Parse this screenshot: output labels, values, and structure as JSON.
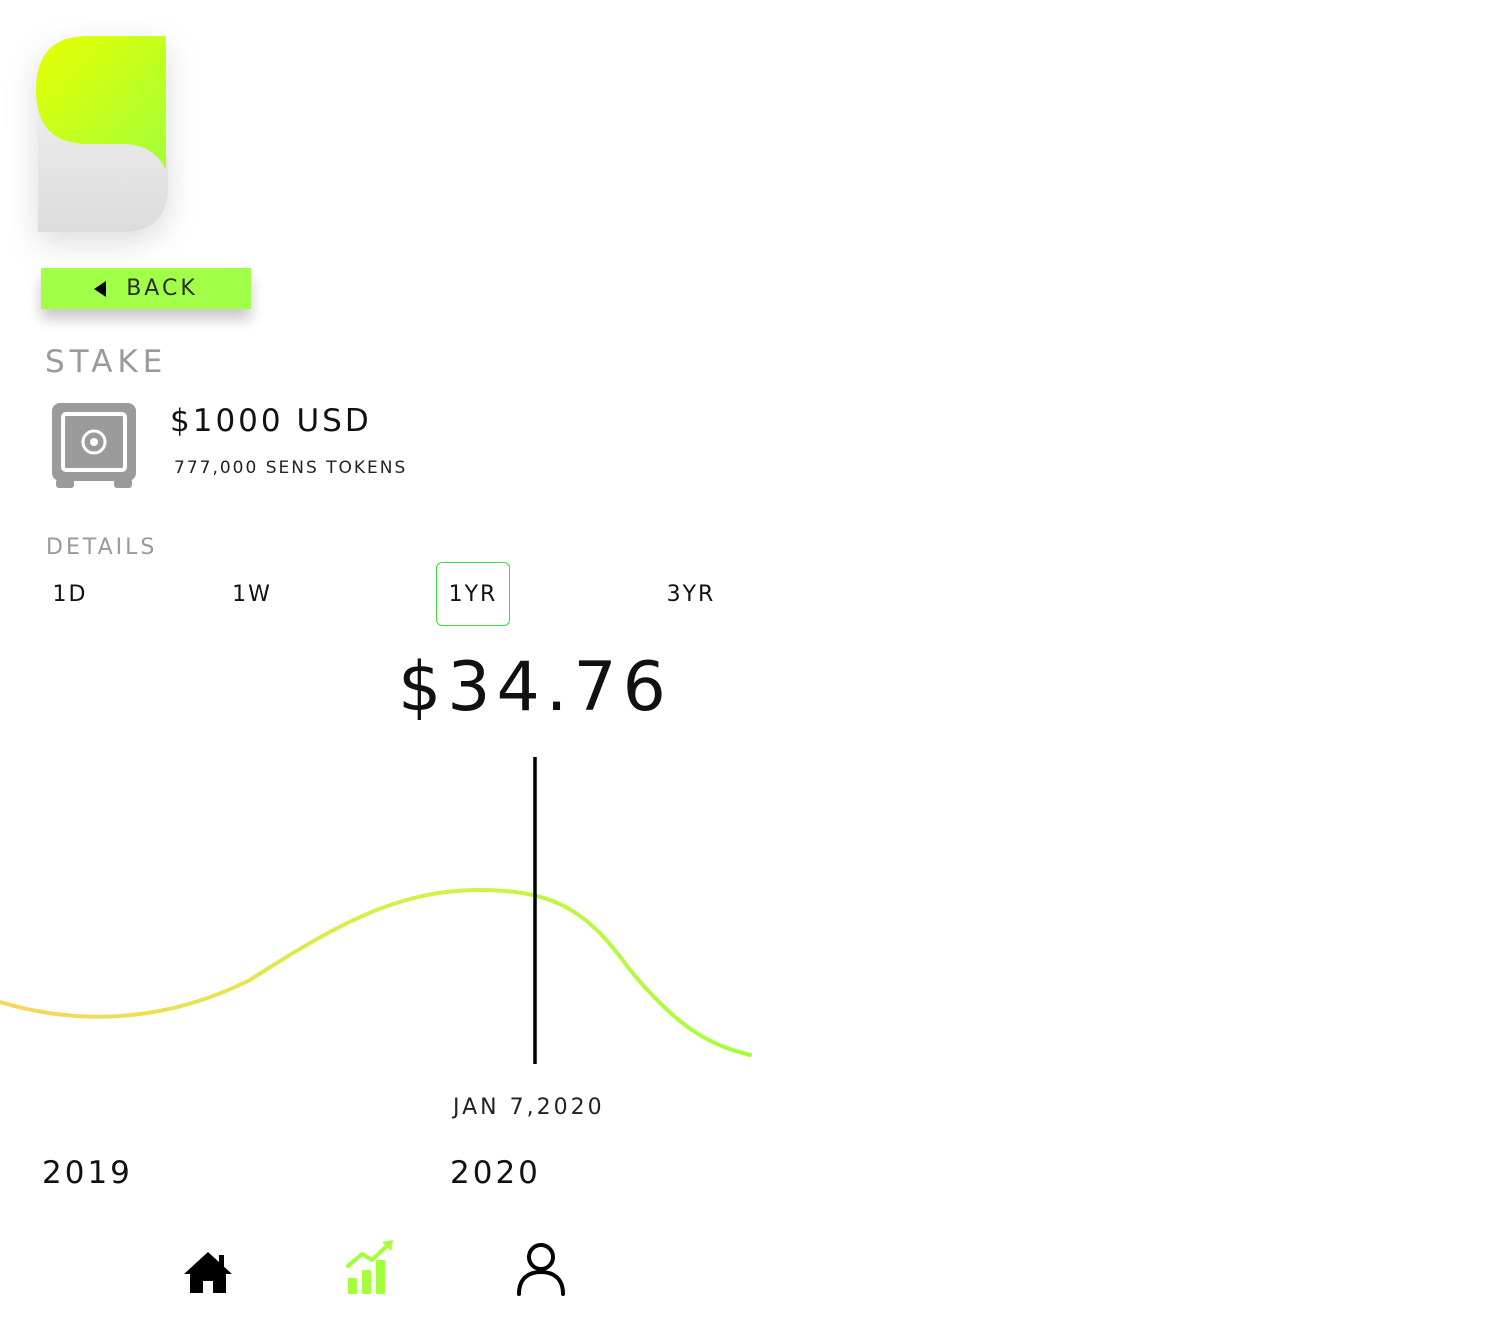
{
  "header": {
    "logo_icon": "s-logo-icon",
    "brand_colors": {
      "top": "#e6ff00",
      "bottom": "#a2ff3a",
      "base": "#e8e8e8"
    }
  },
  "back_button": {
    "label": "BACK",
    "icon": "caret-left-icon"
  },
  "stake": {
    "title": "STAKE",
    "icon": "safe-icon",
    "amount_usd": "$1000 USD",
    "tokens": "777,000 SENS TOKENS"
  },
  "details": {
    "title": "DETAILS",
    "ranges": [
      {
        "label": "1D",
        "active": false
      },
      {
        "label": "1W",
        "active": false
      },
      {
        "label": "1YR",
        "active": true
      },
      {
        "label": "3YR",
        "active": false
      }
    ],
    "price": "$34.76",
    "selected_date": "JAN 7,2020",
    "years": [
      "2019",
      "2020"
    ]
  },
  "chart_data": {
    "type": "line",
    "x_labels": [
      "2019",
      "2020"
    ],
    "cursor_label": "JAN 7,2020",
    "cursor_value": 34.76,
    "gradient": [
      "#f7d65a",
      "#a2ff3a"
    ],
    "grid": false,
    "legend": "none"
  },
  "nav": {
    "items": [
      {
        "icon": "home-icon",
        "active": false
      },
      {
        "icon": "chart-icon",
        "active": true
      },
      {
        "icon": "profile-icon",
        "active": false
      }
    ],
    "active_color": "#a2ff3a"
  }
}
